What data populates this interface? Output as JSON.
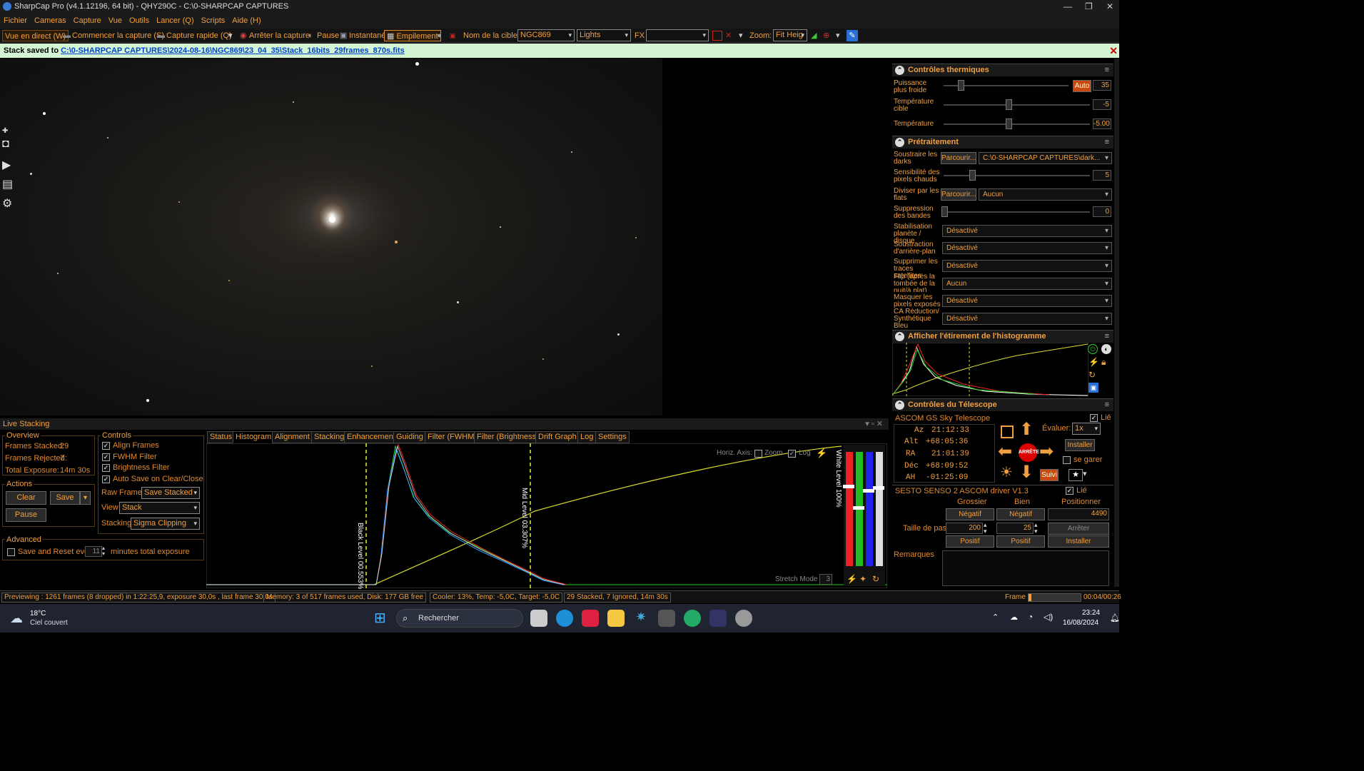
{
  "window": {
    "title": "SharpCap Pro (v4.1.12196, 64 bit) - QHY290C - C:\\0-SHARPCAP CAPTURES"
  },
  "menu": [
    "Fichier",
    "Cameras",
    "Capture",
    "Vue",
    "Outils",
    "Lancer (Q)",
    "Scripts",
    "Aide (H)"
  ],
  "toolbar": {
    "live_view": "Vue en direct (W)",
    "start_capture": "Commencer la capture (S)",
    "quick_capture": "Capture rapide (Q)",
    "stop_capture": "Arrêter la capture",
    "pause": "Pause",
    "snapshot": "Instantané",
    "stacking": "Empilement",
    "target_label": "Nom de la cible:",
    "target_value": "NGC869",
    "frame_type": "Lights",
    "fx_label": "FX",
    "fx_value": "",
    "zoom_label": "Zoom:",
    "zoom_value": "Fit Heig"
  },
  "notice": {
    "prefix": "Stack saved to ",
    "path": "C:\\0-SHARPCAP CAPTURES\\2024-08-16\\NGC869\\23_04_35\\Stack_16bits_29frames_870s.fits"
  },
  "thermal": {
    "title": "Contrôles thermiques",
    "power_label": "Puissance plus froide",
    "power_auto": "Auto",
    "power_value": "35",
    "target_temp_label": "Température cible",
    "target_temp_value": "-5",
    "temp_label": "Température",
    "temp_value": "-5.00"
  },
  "preprocess": {
    "title": "Prétraitement",
    "darks_label": "Soustraire les darks",
    "darks_browse": "Parcourir...",
    "darks_value": "C:\\0-SHARPCAP CAPTURES\\dark...",
    "hotpix_label": "Sensibilité des pixels chauds",
    "hotpix_value": "5",
    "flats_label": "Diviser par les flats",
    "flats_browse": "Parcourir...",
    "flats_value": "Aucun",
    "banding_label": "Suppression des bandes",
    "banding_value": "0",
    "stab_label": "Stabilisation planète / disque",
    "stab_value": "Désactivé",
    "bg_label": "Soustraction d'arrière-plan",
    "bg_value": "Désactivé",
    "sat_label": "Supprimer les traces satellites",
    "sat_value": "Désactivé",
    "flip_label": "Flip (après la tombée de la nuit/à plat)",
    "flip_value": "Aucun",
    "mask_label": "Masquer les pixels exposés",
    "mask_value": "Désactivé",
    "ca_label": "CA Réduction/ Synthétique Bleu",
    "ca_value": "Désactivé"
  },
  "histogram_panel": {
    "title": "Afficher l'étirement de l'histogramme"
  },
  "telescope": {
    "title": "Contrôles du Télescope",
    "driver": "ASCOM GS Sky Telescope",
    "linked_label": "Lié",
    "az_label": "Az",
    "az": "21:12:33",
    "alt_label": "Alt",
    "alt": "+68:05:36",
    "ra_label": "RA",
    "ra": "21:01:39",
    "dec_label": "Déc",
    "dec": "+68:09:52",
    "ah_label": "AH",
    "ah": "-01:25:09",
    "stop_label": "ARRÊTE",
    "rate_label": "Évaluer:",
    "rate_value": "1x",
    "install_label": "Installer",
    "park_label": "se garer",
    "track_label": "Suivi"
  },
  "focuser": {
    "driver": "SESTO SENSO 2 ASCOM driver V1.3",
    "linked_label": "Lié",
    "coarse": "Grossier",
    "fine": "Bien",
    "position": "Positionner",
    "negative": "Négatif",
    "positive": "Positif",
    "position_value": "4490",
    "step_label": "Taille de pas",
    "coarse_step": "200",
    "fine_step": "25",
    "stop": "Arrêter",
    "install": "Installer",
    "remarks": "Remarques"
  },
  "live_stacking": {
    "title": "Live Stacking",
    "overview_title": "Overview",
    "frames_stacked_label": "Frames Stacked:",
    "frames_stacked": "29",
    "frames_rejected_label": "Frames Rejected:",
    "frames_rejected": "7",
    "total_exposure_label": "Total Exposure:",
    "total_exposure": "14m 30s",
    "actions_title": "Actions",
    "clear": "Clear",
    "save": "Save",
    "pause": "Pause",
    "advanced_title": "Advanced",
    "save_reset_label": "Save and Reset every",
    "save_reset_value": "11",
    "save_reset_suffix": "minutes total exposure",
    "controls_title": "Controls",
    "align_frames": "Align Frames",
    "fwhm_filter": "FWHM Filter",
    "brightness_filter": "Brightness Filter",
    "auto_save": "Auto Save on Clear/Close",
    "raw_frames_label": "Raw Frames",
    "raw_frames_value": "Save Stacked",
    "view_label": "View",
    "view_value": "Stack",
    "stacking_label": "Stacking",
    "stacking_value": "Sigma Clipping",
    "tabs": [
      "Status",
      "Histogram",
      "Alignment",
      "Stacking",
      "Enhancement",
      "Guiding",
      "Filter (FWHM)",
      "Filter (Brightness)",
      "Drift Graph",
      "Log",
      "Settings"
    ],
    "histo": {
      "horiz_axis": "Horiz. Axis:",
      "zoom": "Zoom",
      "log": "Log",
      "black_level": "Black Level 00.553%",
      "mid_level": "Mid Level 03.307%",
      "white_level": "White Level 100%",
      "stretch_mode": "Stretch Mode",
      "stretch_value": "3"
    }
  },
  "statusbar": {
    "preview": "Previewing : 1261 frames (8 dropped) in 1:22:25,9, exposure 30,0s , last frame 30,0s",
    "memory": "Memory: 3 of 517 frames used, Disk: 177 GB free",
    "cooler": "Cooler: 13%, Temp: -5,0C, Target: -5,0C",
    "stacked": "29 Stacked, 7 Ignored, 14m 30s",
    "frame_label": "Frame :",
    "frame_time": "00:04/00:26",
    "frame_progress": 0.05
  },
  "taskbar": {
    "weather_temp": "18°C",
    "weather_desc": "Ciel couvert",
    "search": "Rechercher",
    "time": "23:24",
    "date": "16/08/2024"
  },
  "colors": {
    "accent": "#f0a040",
    "notice_bg": "#d4f5d4",
    "taskbar": "#1f2430"
  }
}
